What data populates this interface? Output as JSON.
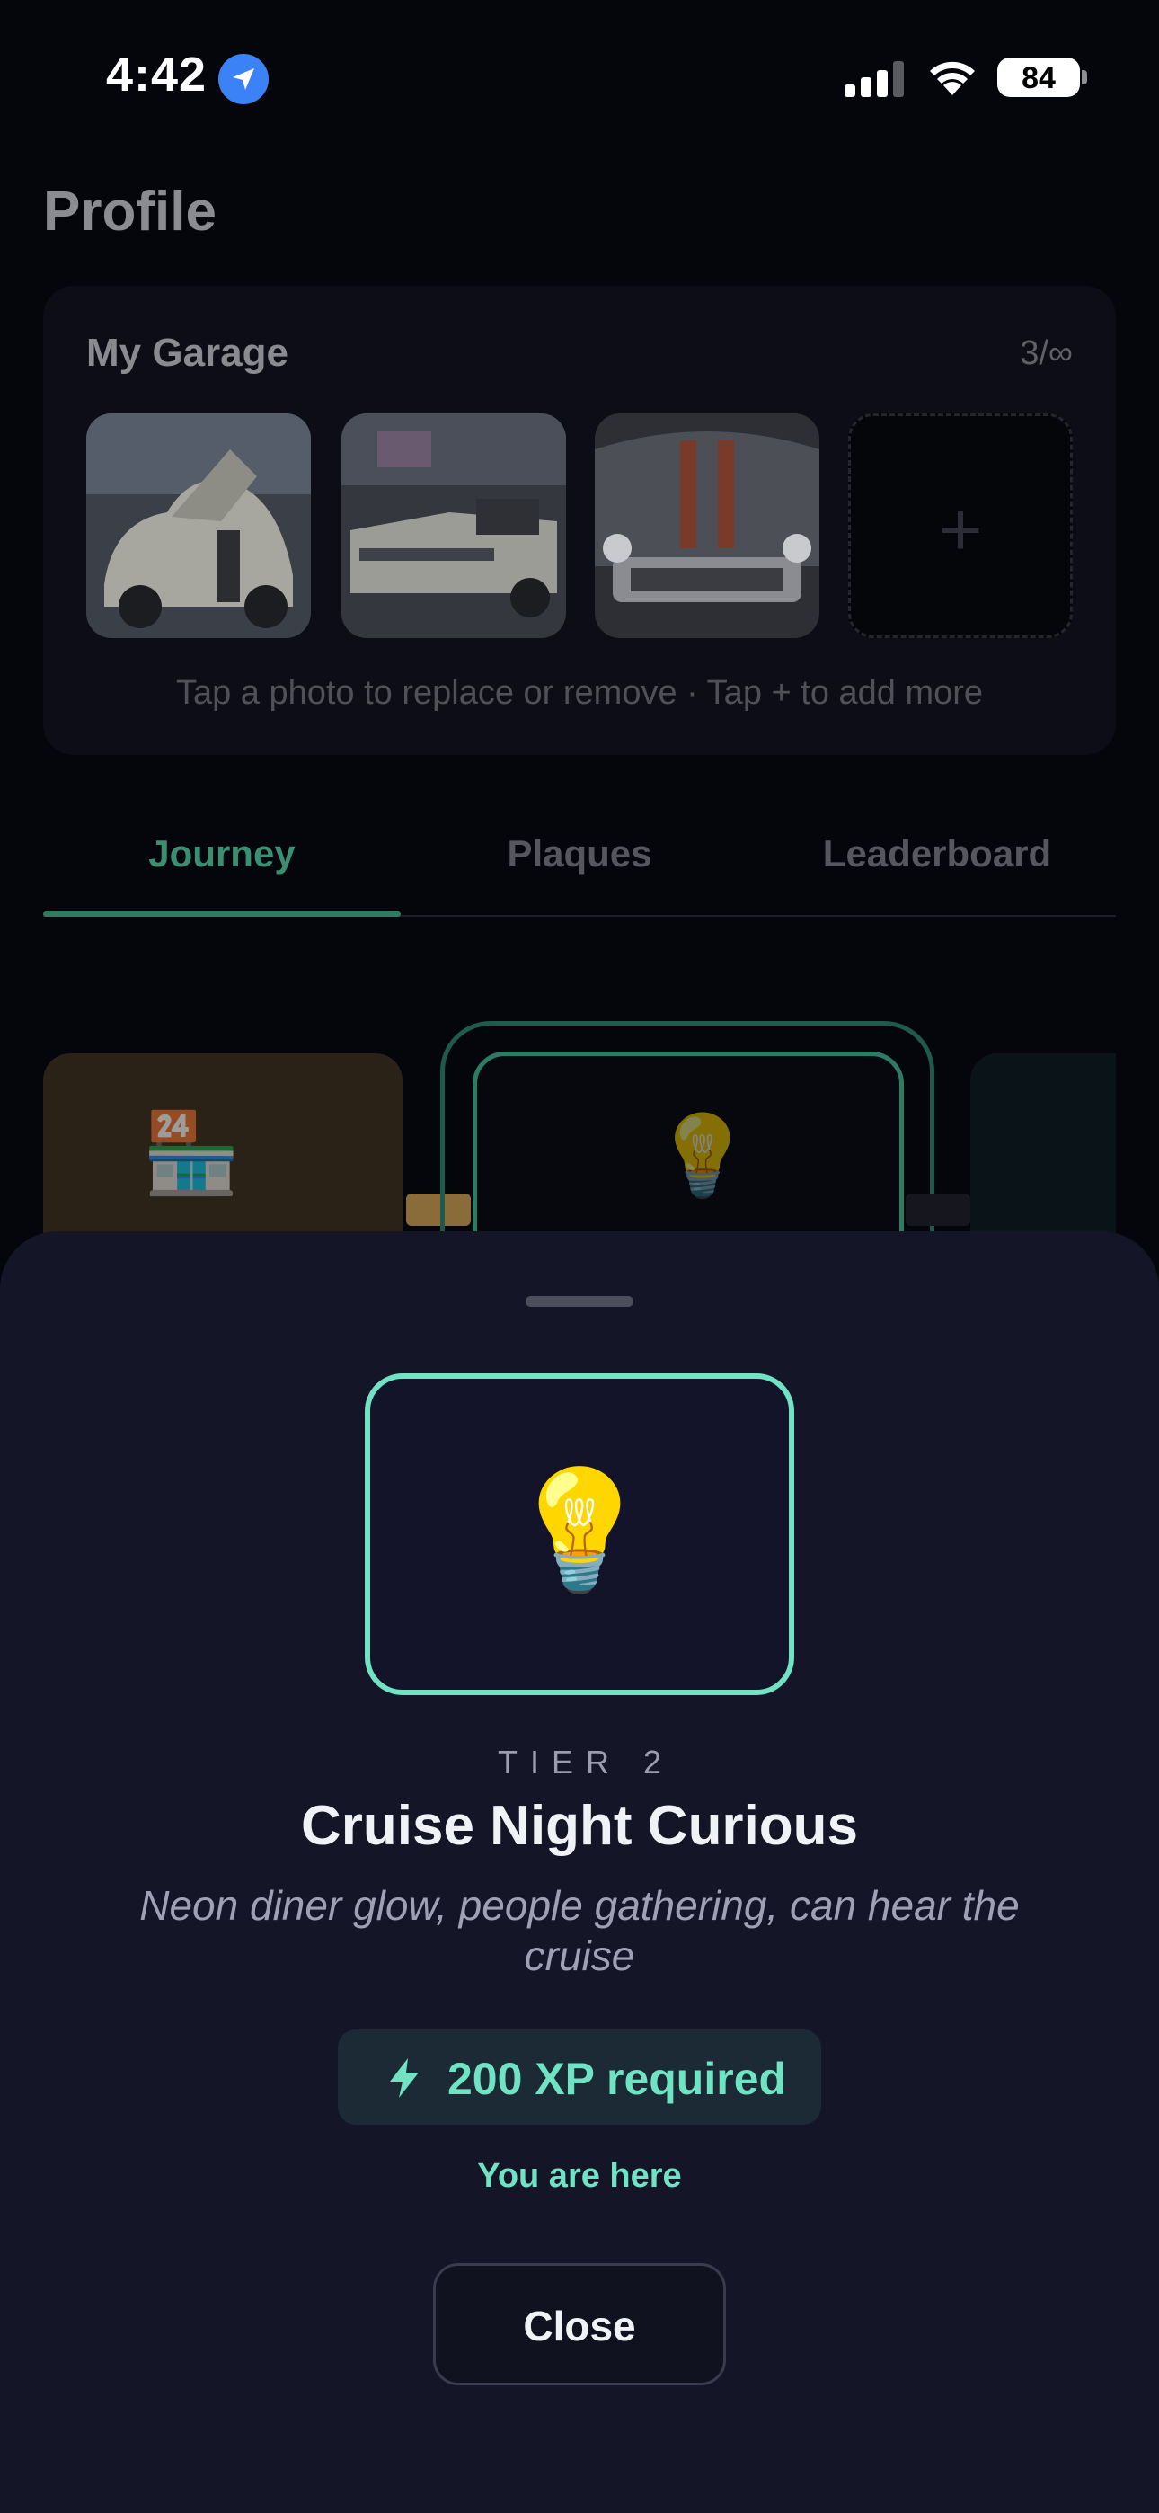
{
  "status_bar": {
    "time": "4:42",
    "battery": "84"
  },
  "profile": {
    "title": "Profile",
    "garage": {
      "title": "My Garage",
      "count": "3/∞",
      "hint": "Tap a photo to replace or remove · Tap + to add more",
      "add_label": "+"
    },
    "tabs": [
      {
        "label": "Journey",
        "active": true
      },
      {
        "label": "Plaques",
        "active": false
      },
      {
        "label": "Leaderboard",
        "active": false
      }
    ],
    "journey": {
      "prev_icon": "🏪",
      "current_icon": "💡"
    }
  },
  "sheet": {
    "badge_icon": "💡",
    "tier": "TIER 2",
    "title": "Cruise Night Curious",
    "description": "Neon diner glow, people gathering, can hear the cruise",
    "xp": "200 XP required",
    "status": "You are here",
    "close_label": "Close"
  },
  "colors": {
    "accent": "#6fe3c4",
    "sheet_bg": "#141527",
    "page_bg": "#05060b"
  }
}
